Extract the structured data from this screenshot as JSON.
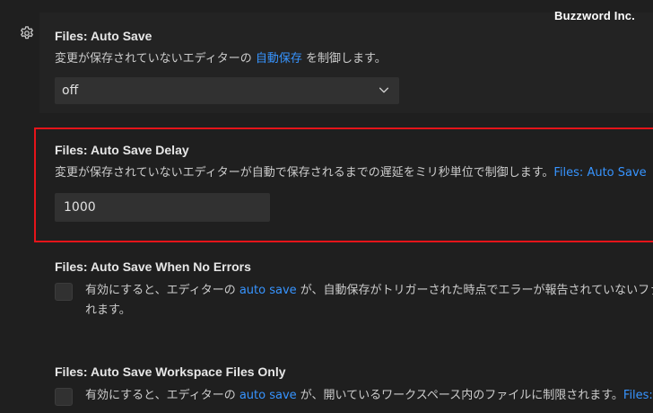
{
  "watermark": "Buzzword Inc.",
  "settings": {
    "auto_save": {
      "category": "Files: ",
      "name": "Auto Save",
      "desc_prefix": "変更が保存されていないエディターの ",
      "desc_link": "自動保存",
      "desc_suffix": " を制御します。",
      "select_value": "off"
    },
    "auto_save_delay": {
      "category": "Files: ",
      "name": "Auto Save Delay",
      "desc_text": "変更が保存されていないエディターが自動で保存されるまでの遅延をミリ秒単位で制御します。",
      "desc_link": "Files: Auto Save",
      "input_value": "1000"
    },
    "auto_save_when_no_errors": {
      "category": "Files: ",
      "name": "Auto Save When No Errors",
      "desc_prefix": "有効にすると、エディターの ",
      "desc_link": "auto save",
      "desc_suffix": " が、自動保存がトリガーされた時点でエラーが報告されていないファイ",
      "desc_line2": "れます。",
      "checked": false
    },
    "auto_save_workspace_files_only": {
      "category": "Files: ",
      "name": "Auto Save Workspace Files Only",
      "desc_prefix": "有効にすると、エディターの ",
      "desc_link": "auto save",
      "desc_suffix": " が、開いているワークスペース内のファイルに制限されます。",
      "desc_link2": "Files: Aut",
      "checked": false
    }
  },
  "colors": {
    "background": "#1f1f1f",
    "link": "#3794ff",
    "highlight_border": "#e5141a",
    "control_bg": "#313131"
  },
  "icons": {
    "gear": "gear-icon",
    "chevron": "chevron-down-icon"
  }
}
